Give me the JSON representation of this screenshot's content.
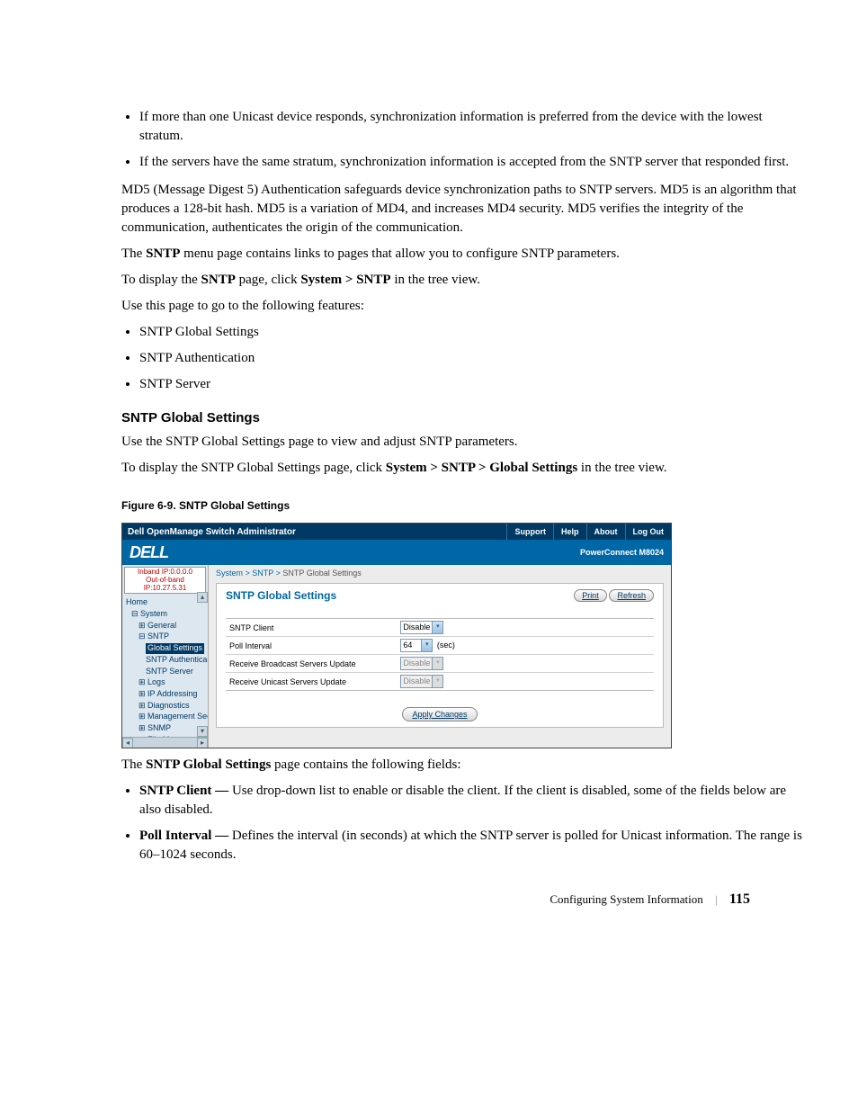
{
  "bullets_top": [
    "If more than one Unicast device responds, synchronization information is preferred from the device with the lowest stratum.",
    "If the servers have the same stratum, synchronization information is accepted from the SNTP server that responded first."
  ],
  "para_md5": "MD5 (Message Digest 5) Authentication safeguards device synchronization paths to SNTP servers. MD5 is an algorithm that produces a 128-bit hash. MD5 is a variation of MD4, and increases MD4 security. MD5 verifies the integrity of the communication, authenticates the origin of the communication.",
  "para_menu_pre": "The ",
  "para_menu_bold1": "SNTP",
  "para_menu_post": " menu page contains links to pages that allow you to configure SNTP parameters.",
  "para_display_pre": "To display the ",
  "para_display_bold1": "SNTP",
  "para_display_mid": " page, click ",
  "para_display_bold2": "System > SNTP",
  "para_display_post": " in the tree view.",
  "para_usepage": "Use this page to go to the following features:",
  "feature_bullets": [
    "SNTP Global Settings",
    "SNTP Authentication",
    "SNTP Server"
  ],
  "heading_sgs": "SNTP Global Settings",
  "para_sgs_use": "Use the SNTP Global Settings page to view and adjust SNTP parameters.",
  "para_sgs_disp_pre": "To display the SNTP Global Settings page, click ",
  "para_sgs_disp_bold": "System > SNTP > Global Settings",
  "para_sgs_disp_post": " in the tree view.",
  "figure_caption": "Figure 6-9.    SNTP Global Settings",
  "screenshot": {
    "titlebar_title": "Dell OpenManage Switch Administrator",
    "nav": {
      "support": "Support",
      "help": "Help",
      "about": "About",
      "logout": "Log Out"
    },
    "brand": "DELL",
    "model": "PowerConnect M8024",
    "ip_inband": "Inband IP:0.0.0.0",
    "ip_oob": "Out-of-band IP:10.27.5.31",
    "tree": {
      "home": "Home",
      "system": "System",
      "general": "General",
      "sntp": "SNTP",
      "global_settings": "Global Settings",
      "sntp_auth": "SNTP Authentica",
      "sntp_server": "SNTP Server",
      "logs": "Logs",
      "ip_addr": "IP Addressing",
      "diag": "Diagnostics",
      "mgmt_sec": "Management Secur",
      "snmp": "SNMP",
      "file_mgmt": "File Management"
    },
    "crumb": {
      "a": "System",
      "b": "SNTP",
      "c": "SNTP Global Settings"
    },
    "panel_title": "SNTP Global Settings",
    "btn_print": "Print",
    "btn_refresh": "Refresh",
    "fields": {
      "sntp_client_label": "SNTP Client",
      "sntp_client_value": "Disable",
      "poll_interval_label": "Poll Interval",
      "poll_interval_value": "64",
      "poll_interval_unit": "(sec)",
      "rbsu_label": "Receive Broadcast Servers Update",
      "rbsu_value": "Disable",
      "rusu_label": "Receive Unicast Servers Update",
      "rusu_value": "Disable"
    },
    "btn_apply": "Apply Changes"
  },
  "para_after_fig_pre": "The ",
  "para_after_fig_bold": "SNTP Global Settings",
  "para_after_fig_post": " page contains the following fields:",
  "field_bullets": [
    {
      "bold": "SNTP Client — ",
      "rest": "Use drop-down list to enable or disable the client. If the client is disabled, some of the fields below are also disabled."
    },
    {
      "bold": "Poll Interval — ",
      "rest": "Defines the interval (in seconds) at which the SNTP server is polled for Unicast information. The range is 60–1024 seconds."
    }
  ],
  "footer_section": "Configuring System Information",
  "footer_page": "115"
}
